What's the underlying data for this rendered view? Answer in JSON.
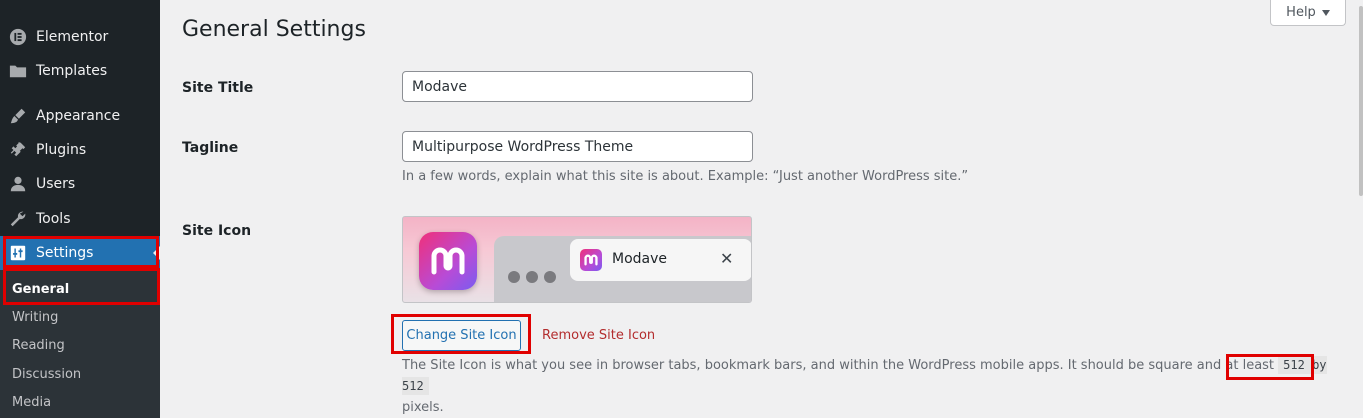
{
  "sidebar": {
    "items": [
      {
        "label": "Elementor",
        "icon": "elementor-icon"
      },
      {
        "label": "Templates",
        "icon": "folder-icon"
      },
      {
        "label": "Appearance",
        "icon": "paintbrush-icon"
      },
      {
        "label": "Plugins",
        "icon": "plugin-icon"
      },
      {
        "label": "Users",
        "icon": "user-icon"
      },
      {
        "label": "Tools",
        "icon": "wrench-icon"
      },
      {
        "label": "Settings",
        "icon": "settings-sliders-icon",
        "active": true
      }
    ],
    "submenu": [
      "General",
      "Writing",
      "Reading",
      "Discussion",
      "Media"
    ],
    "current_submenu": "General"
  },
  "header": {
    "help_label": "Help",
    "page_title": "General Settings"
  },
  "form": {
    "site_title": {
      "label": "Site Title",
      "value": "Modave"
    },
    "tagline": {
      "label": "Tagline",
      "value": "Multipurpose WordPress Theme",
      "description": "In a few words, explain what this site is about. Example: “Just another WordPress site.”"
    },
    "site_icon": {
      "label": "Site Icon",
      "preview_tab_title": "Modave",
      "change_button": "Change Site Icon",
      "remove_link": "Remove Site Icon",
      "description_before": "The Site Icon is what you see in browser tabs, bookmark bars, and within the WordPress mobile apps. It should be square and at least ",
      "description_code": "512 by 512",
      "description_after": "pixels."
    }
  },
  "colors": {
    "sidebar_bg": "#1d2327",
    "accent": "#2271b1",
    "highlight": "#e00000",
    "danger_link": "#b32d2e"
  }
}
